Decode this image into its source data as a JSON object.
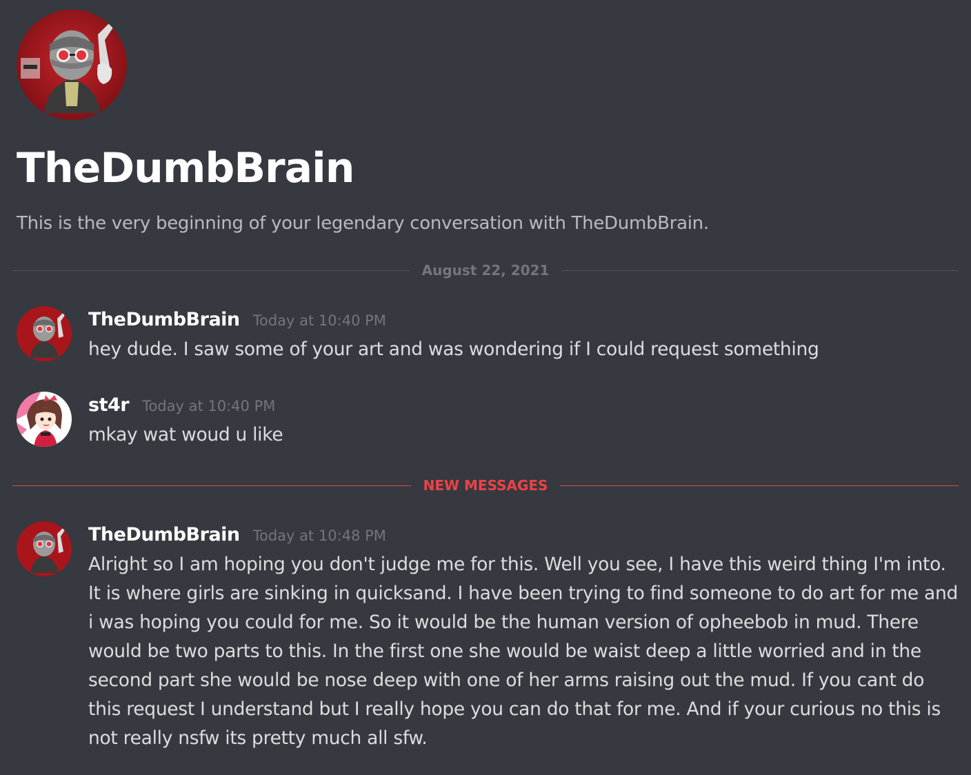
{
  "conversation": {
    "title": "TheDumbBrain",
    "intro": "This is the very beginning of your legendary conversation with TheDumbBrain."
  },
  "dividers": {
    "date": "August 22, 2021",
    "new_messages": "NEW MESSAGES"
  },
  "messages": [
    {
      "author": "TheDumbBrain",
      "timestamp": "Today at 10:40 PM",
      "text": "hey dude. I saw some of your art and was wondering if I could request something",
      "avatar_icon": "masked-character-avatar"
    },
    {
      "author": "st4r",
      "timestamp": "Today at 10:40 PM",
      "text": "mkay wat woud u like",
      "avatar_icon": "anime-girl-avatar"
    },
    {
      "author": "TheDumbBrain",
      "timestamp": "Today at 10:48 PM",
      "text": "Alright so I am hoping you don't judge me for this. Well you see, I have this weird thing I'm into. It is where girls are sinking in quicksand. I have been trying to find someone to do art for me and i was hoping you could for me. So it would be the human version of opheebob in mud. There would be two parts to this. In the first one she would be waist deep a little worried and in the second part she would be nose deep with one of her arms raising out the mud. If you cant do this request I understand but I really hope you can do that for me. And if your curious no this is not really nsfw its pretty much all sfw.",
      "avatar_icon": "masked-character-avatar"
    }
  ],
  "colors": {
    "background": "#36393f",
    "username": "#ffffff",
    "timestamp": "#72767d",
    "message_text": "#dcddde",
    "new_messages_accent": "#ed4245",
    "avatar_red": "#a8161c"
  }
}
